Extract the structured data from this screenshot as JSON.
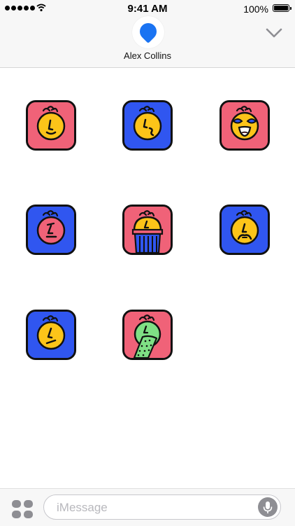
{
  "status_bar": {
    "time": "9:41 AM",
    "battery_percent": "100%",
    "signal_dots": 5,
    "icons": [
      "signal-dots-icon",
      "wifi-icon",
      "battery-icon"
    ]
  },
  "header": {
    "contact_name": "Alex Collins",
    "avatar_icon": "blue-blob-avatar",
    "collapse_icon": "chevron-down-icon"
  },
  "stickers": [
    {
      "face": "smirk",
      "bg": "#f06278"
    },
    {
      "face": "thinking",
      "bg": "#3056f0"
    },
    {
      "face": "laughing",
      "bg": "#f06278"
    },
    {
      "face": "annoyed",
      "bg": "#3056f0"
    },
    {
      "face": "ice-cream",
      "bg": "#f06278"
    },
    {
      "face": "mustache",
      "bg": "#3056f0"
    },
    {
      "face": "worried",
      "bg": "#3056f0"
    },
    {
      "face": "vomiting",
      "bg": "#f06278"
    }
  ],
  "colors": {
    "red_bg": "#f06278",
    "blue_bg": "#3056f0",
    "face_yellow": "#fcc419",
    "green_face": "#7fe085",
    "ink": "#111111"
  },
  "bottom_bar": {
    "placeholder": "iMessage",
    "apps_icon": "app-drawer-icon",
    "mic_icon": "microphone-icon"
  }
}
